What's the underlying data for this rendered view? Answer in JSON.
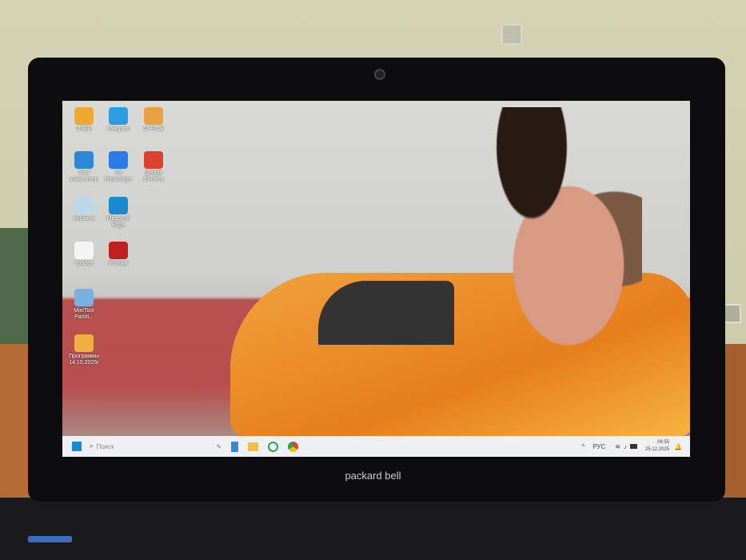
{
  "desktop_icons": [
    {
      "label": "USER",
      "color": "#f0a830"
    },
    {
      "label": "Telegram",
      "color": "#2a9ee0"
    },
    {
      "label": "OFFICE",
      "color": "#e8a040"
    },
    {
      "label": "Этот компьютер",
      "color": "#2a8ad8"
    },
    {
      "label": "VK Messenger",
      "color": "#2a7ae8"
    },
    {
      "label": "Google Chrome",
      "color": "#e04030"
    },
    {
      "label": "Корзина",
      "color": "#bcd8e8"
    },
    {
      "label": "Microsoft Edge",
      "color": "#1a8ad0"
    },
    {
      "label": "Yandex",
      "color": "#f4f4f4"
    },
    {
      "label": "Ритмик",
      "color": "#c02020"
    },
    {
      "label": "MiniTool Partiti...",
      "color": "#7ab0e0"
    },
    {
      "label": "Программы 14.10.2025г",
      "color": "#f0b040"
    }
  ],
  "taskbar": {
    "search_placeholder": "Поиск",
    "language": "РУС",
    "time": "06:55",
    "date": "25.12.2025"
  },
  "laptop": {
    "brand": "packard bell"
  }
}
